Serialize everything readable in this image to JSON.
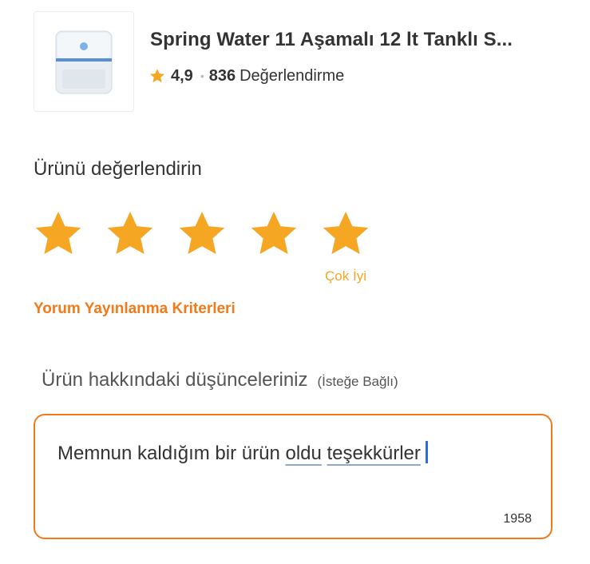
{
  "product": {
    "title": "Spring Water 11 Aşamalı 12 lt Tanklı S...",
    "image_icon": "water-purifier-image",
    "rating": "4,9",
    "separator": "•",
    "review_count": "836",
    "review_label": "Değerlendirme"
  },
  "rate_section": {
    "title": "Ürünü değerlendirin",
    "selected_stars": 5,
    "max_stars": 5,
    "selected_label": "Çok İyi",
    "star_color": "#f5a623"
  },
  "criteria_link": "Yorum Yayınlanma Kriterleri",
  "comment": {
    "label": "Ürün hakkındaki düşünceleriniz",
    "optional": "(İsteğe Bağlı)",
    "text_part1": "Memnun kaldığım bir ürün",
    "text_part2": "oldu",
    "text_part3": "teşekkürler",
    "remaining_chars": "1958"
  },
  "colors": {
    "accent": "#f27a1a",
    "star": "#f5a623",
    "caret": "#2d6be0"
  }
}
